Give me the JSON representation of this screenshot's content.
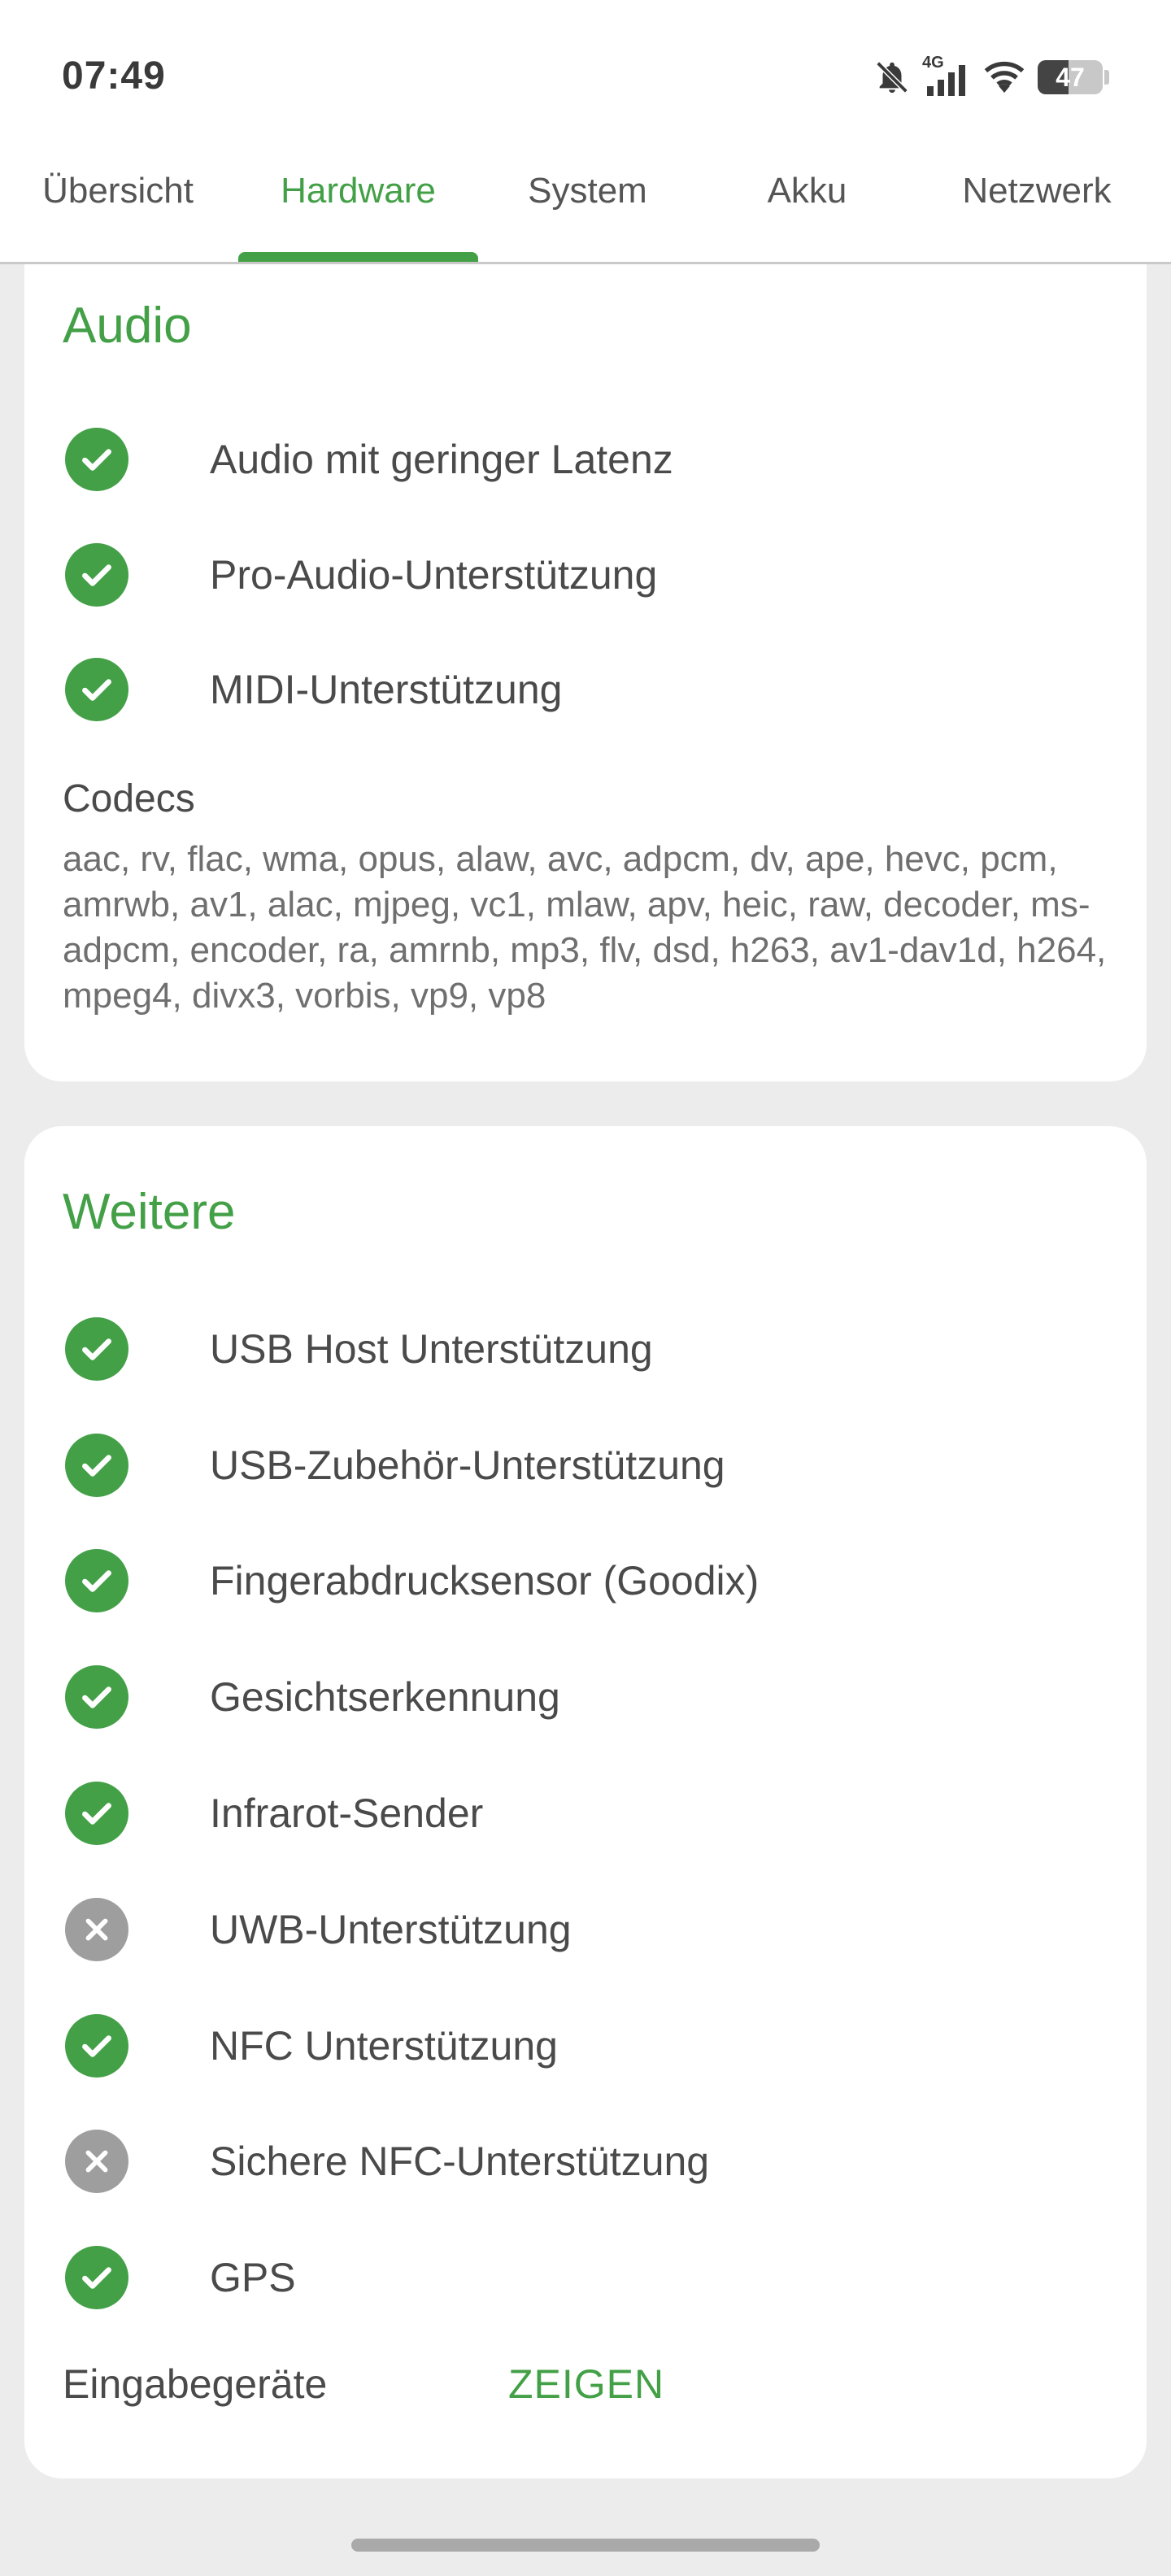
{
  "status_bar": {
    "time": "07:49",
    "network": "4G",
    "battery": "47",
    "icons": [
      "bell-muted-icon",
      "signal-icon",
      "wifi-icon",
      "battery-icon"
    ]
  },
  "tabs": [
    {
      "label": "Übersicht",
      "active": false
    },
    {
      "label": "Hardware",
      "active": true
    },
    {
      "label": "System",
      "active": false
    },
    {
      "label": "Akku",
      "active": false
    },
    {
      "label": "Netzwerk",
      "active": false
    }
  ],
  "audio_card": {
    "title": "Audio",
    "features": [
      {
        "label": "Audio mit geringer Latenz",
        "supported": true
      },
      {
        "label": "Pro-Audio-Unterstützung",
        "supported": true
      },
      {
        "label": "MIDI-Unterstützung",
        "supported": true
      }
    ],
    "codecs_title": "Codecs",
    "codecs_text": "aac, rv, flac, wma, opus, alaw, avc, adpcm, dv, ape, hevc, pcm, amrwb, av1, alac, mjpeg, vc1, mlaw, apv, heic, raw, decoder, ms-adpcm, encoder, ra, amrnb, mp3, flv, dsd, h263, av1-dav1d, h264, mpeg4, divx3, vorbis, vp9, vp8"
  },
  "more_card": {
    "title": "Weitere",
    "features": [
      {
        "label": "USB Host Unterstützung",
        "supported": true
      },
      {
        "label": "USB-Zubehör-Unterstützung",
        "supported": true
      },
      {
        "label": "Fingerabdrucksensor (Goodix)",
        "supported": true
      },
      {
        "label": "Gesichtserkennung",
        "supported": true
      },
      {
        "label": "Infrarot-Sender",
        "supported": true
      },
      {
        "label": "UWB-Unterstützung",
        "supported": false
      },
      {
        "label": "NFC Unterstützung",
        "supported": true
      },
      {
        "label": "Sichere NFC-Unterstützung",
        "supported": false
      },
      {
        "label": "GPS",
        "supported": true
      }
    ],
    "input_devices_label": "Eingabegeräte",
    "show_button": "ZEIGEN"
  },
  "colors": {
    "accent": "#43a047",
    "unsupported": "#9e9e9e",
    "background": "#ececec"
  }
}
